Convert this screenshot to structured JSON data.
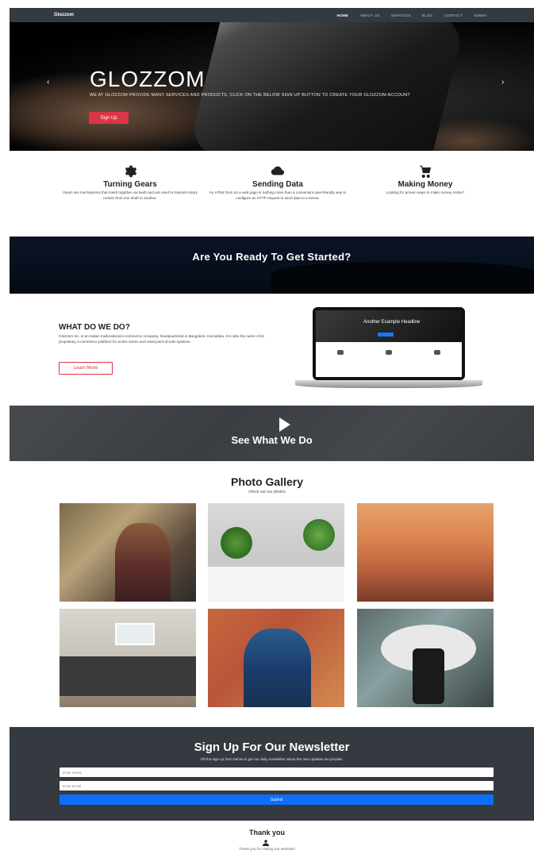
{
  "navbar": {
    "brand": "Glozzom",
    "links": [
      "HOME",
      "ABOUT US",
      "SERVICES",
      "BLOG",
      "CONTACT",
      "ADMIN"
    ]
  },
  "hero": {
    "title": "GLOZZOM",
    "text": "WE AT GLOZZOM PROVIDE MANY SERVICES AND PRODUCTS, CLICK ON THE BELOW SIGN UP BUTTON TO CREATE YOUR GLOZZOM ACCOUNT",
    "button": "Sign Up",
    "prev_icon": "chevron-left-icon",
    "next_icon": "chevron-right-icon"
  },
  "features": [
    {
      "icon": "gear-icon",
      "title": "Turning Gears",
      "text": "Gears are mechanisms that mesh together via teeth and are used to transmit rotary motion from one shaft to another."
    },
    {
      "icon": "cloud-icon",
      "title": "Sending Data",
      "text": "An HTML form on a web page is nothing more than a convenient user-friendly way to configure an HTTP request to send data to a server."
    },
    {
      "icon": "cart-icon",
      "title": "Making Money",
      "text": "Looking for proven ways to make money online?"
    }
  ],
  "banner": {
    "title": "Are You Ready To Get Started?"
  },
  "what": {
    "title": "WHAT DO WE DO?",
    "text": "Glozzom Inc. is an Indian multinational e-commerce company, headquartered in Bangalore, Karnataka. It is also the name of its proprietary e-commerce platform for online stores and retail point-of-sale systems.",
    "button": "Learn More",
    "laptop_heading": "Another Example Headline"
  },
  "video": {
    "title": "See What We Do",
    "icon": "play-icon"
  },
  "gallery": {
    "title": "Photo Gallery",
    "subtitle": "check out our photos"
  },
  "newsletter": {
    "title": "Sign Up For Our Newsletter",
    "text": "Fill the sign up form below to get our daily newsletter about the new updates we provide.",
    "name_placeholder": "Enter Name",
    "email_placeholder": "Enter Email",
    "button": "Submit"
  },
  "thankyou": {
    "title": "Thank you",
    "text": "Thank you for visiting our website!!",
    "icon": "person-icon"
  },
  "colors": {
    "navbar": "#343a40",
    "accent_red": "#dc3545",
    "primary_blue": "#0d6efd"
  }
}
